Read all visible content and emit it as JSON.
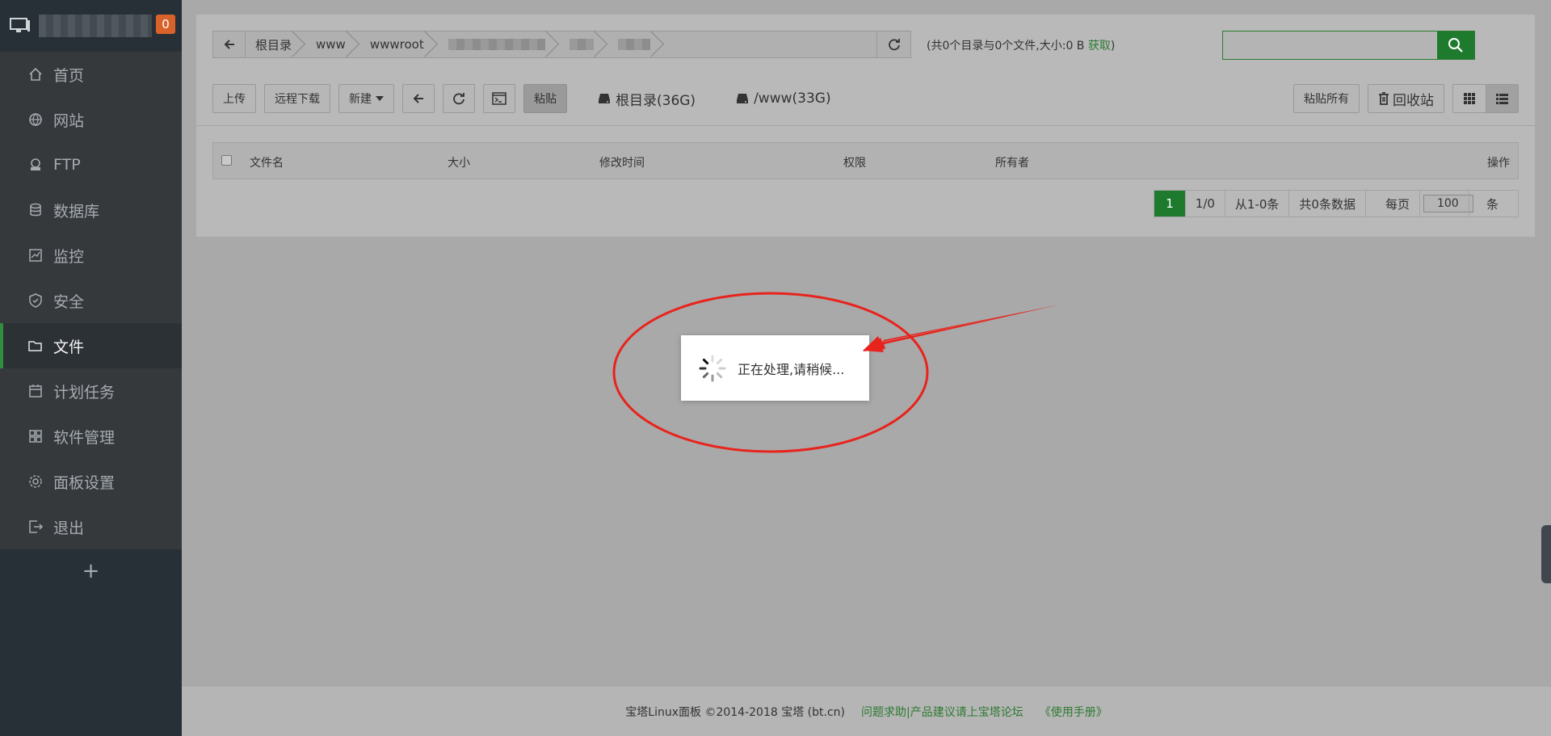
{
  "sidebar": {
    "badge": "0",
    "items": [
      {
        "label": "首页",
        "icon": "home-icon"
      },
      {
        "label": "网站",
        "icon": "globe-icon"
      },
      {
        "label": "FTP",
        "icon": "ftp-icon"
      },
      {
        "label": "数据库",
        "icon": "database-icon"
      },
      {
        "label": "监控",
        "icon": "monitor-icon"
      },
      {
        "label": "安全",
        "icon": "shield-icon"
      },
      {
        "label": "文件",
        "icon": "folder-icon"
      },
      {
        "label": "计划任务",
        "icon": "calendar-icon"
      },
      {
        "label": "软件管理",
        "icon": "apps-icon"
      },
      {
        "label": "面板设置",
        "icon": "gear-icon"
      },
      {
        "label": "退出",
        "icon": "logout-icon"
      }
    ],
    "add": "+"
  },
  "path": {
    "crumbs": [
      "根目录",
      "www",
      "wwwroot"
    ],
    "info_prefix": "(共0个目录与0个文件,大小:0 B ",
    "info_link": "获取",
    "info_suffix": ")"
  },
  "toolbar": {
    "upload": "上传",
    "remote_download": "远程下载",
    "new": "新建",
    "paste": "粘贴",
    "disk_root": "根目录(36G)",
    "disk_www": "/www(33G)",
    "paste_all": "粘贴所有",
    "recycle": "回收站"
  },
  "table": {
    "columns": [
      "文件名",
      "大小",
      "修改时间",
      "权限",
      "所有者",
      "操作"
    ]
  },
  "pager": {
    "current": "1",
    "pages": "1/0",
    "range": "从1-0条",
    "total": "共0条数据",
    "per_page_label": "每页",
    "per_page_value": "100",
    "unit": "条"
  },
  "loading": {
    "text": "正在处理,请稍候..."
  },
  "footer": {
    "copyright": "宝塔Linux面板 ©2014-2018 宝塔 (bt.cn)",
    "forum": "问题求助|产品建议请上宝塔论坛",
    "manual": "《使用手册》"
  },
  "colors": {
    "accent": "#1e7b2e",
    "annotation": "#e8231c",
    "badge": "#d9622b"
  }
}
